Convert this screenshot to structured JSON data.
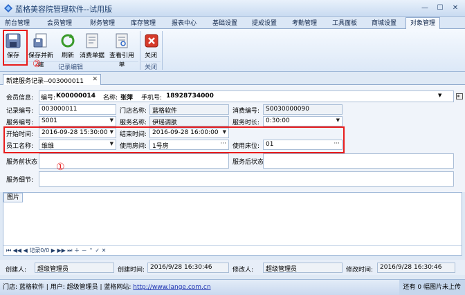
{
  "window": {
    "title": "蓝格美容院管理软件--试用版"
  },
  "menu_tabs": [
    "前台管理",
    "会员管理",
    "财务管理",
    "库存管理",
    "报表中心",
    "基础设置",
    "提成设置",
    "考勤管理",
    "工具面板",
    "商城设置",
    "对象管理"
  ],
  "ribbon": {
    "buttons": {
      "save": "保存",
      "save_new": "保存并新建",
      "refresh": "刷新",
      "consume_bill": "消费单据",
      "view_ref": "查看引用单",
      "close": "关闭"
    },
    "groups": {
      "record_edit": "记录编辑",
      "close": "关闭"
    },
    "annotation_2": "②",
    "annotation_1": "①"
  },
  "doc_tab": {
    "label": "新建服务记录--003000011"
  },
  "form": {
    "member_label": "会员信息:",
    "member_no_label": "编号:",
    "member_no": "K00000014",
    "member_name_label": "名称:",
    "member_name": "张萍",
    "member_phone_label": "手机号:",
    "member_phone": "18928734000",
    "record_no_label": "记录编号:",
    "record_no": "003000011",
    "store_label": "门店名称:",
    "store": "蓝格软件",
    "bill_no_label": "消费编号:",
    "bill_no": "S0030000090",
    "service_no_label": "服务编号:",
    "service_no": "S001",
    "service_name_label": "服务名称:",
    "service_name": "伊瑶调肤",
    "duration_label": "服务时长:",
    "duration": "0:30:00",
    "start_label": "开始时间:",
    "start": "2016-09-28 15:30:00",
    "end_label": "结束时间:",
    "end": "2016-09-28 16:00:00",
    "staff_label": "员工名称:",
    "staff": "维维",
    "room_label": "使用房间:",
    "room": "1号房",
    "bed_label": "使用床位:",
    "bed": "01",
    "before_label": "服务前状态",
    "after_label": "服务后状态",
    "detail_label": "服务细节:"
  },
  "picture": {
    "tab": "图片",
    "nav_record": "记录0/0"
  },
  "info": {
    "creator_label": "创建人:",
    "creator": "超级管理员",
    "created_label": "创建时间:",
    "created": "2016/9/28 16:30:46",
    "modifier_label": "修改人:",
    "modifier": "超级管理员",
    "modified_label": "修改时间:",
    "modified": "2016/9/28 16:30:46"
  },
  "status": {
    "store": "门店: 蓝格软件",
    "user": "用户: 超级管理员",
    "site_label": "蓝格网站:",
    "site_url": "http://www.lange.com.cn",
    "right": "还有 0 幅图片未上传"
  }
}
